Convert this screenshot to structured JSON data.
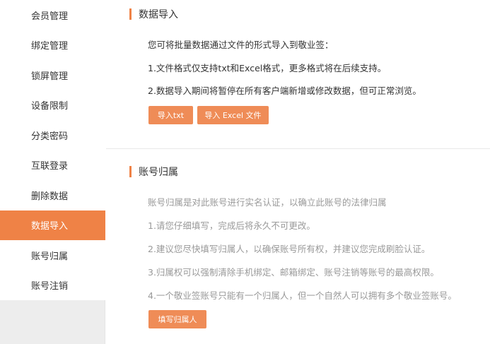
{
  "sidebar": {
    "items": [
      {
        "label": "会员管理"
      },
      {
        "label": "绑定管理"
      },
      {
        "label": "锁屏管理"
      },
      {
        "label": "设备限制"
      },
      {
        "label": "分类密码"
      },
      {
        "label": "互联登录"
      },
      {
        "label": "删除数据"
      },
      {
        "label": "数据导入"
      },
      {
        "label": "账号归属"
      },
      {
        "label": "账号注销"
      }
    ],
    "active_index": 7
  },
  "import_section": {
    "title": "数据导入",
    "lines": [
      "您可将批量数据通过文件的形式导入到敬业签：",
      "1.文件格式仅支持txt和Excel格式，更多格式将在后续支持。",
      "2.数据导入期间将暂停在所有客户端新增或修改数据，但可正常浏览。"
    ],
    "btn_txt": "导入txt",
    "btn_excel": "导入 Excel 文件"
  },
  "ownership_section": {
    "title": "账号归属",
    "lines": [
      "账号归属是对此账号进行实名认证，以确立此账号的法律归属",
      "1.请您仔细填写，完成后将永久不可更改。",
      "2.建议您尽快填写归属人，以确保账号所有权，并建议您完成刷脸认证。",
      "3.归属权可以强制清除手机绑定、邮箱绑定、账号注销等账号的最高权限。",
      "4.一个敬业签账号只能有一个归属人，但一个自然人可以拥有多个敬业签账号。"
    ],
    "btn_owner": "填写归属人"
  },
  "colors": {
    "accent": "#ef8246",
    "button": "#ef8c57",
    "muted_text": "#999999"
  }
}
